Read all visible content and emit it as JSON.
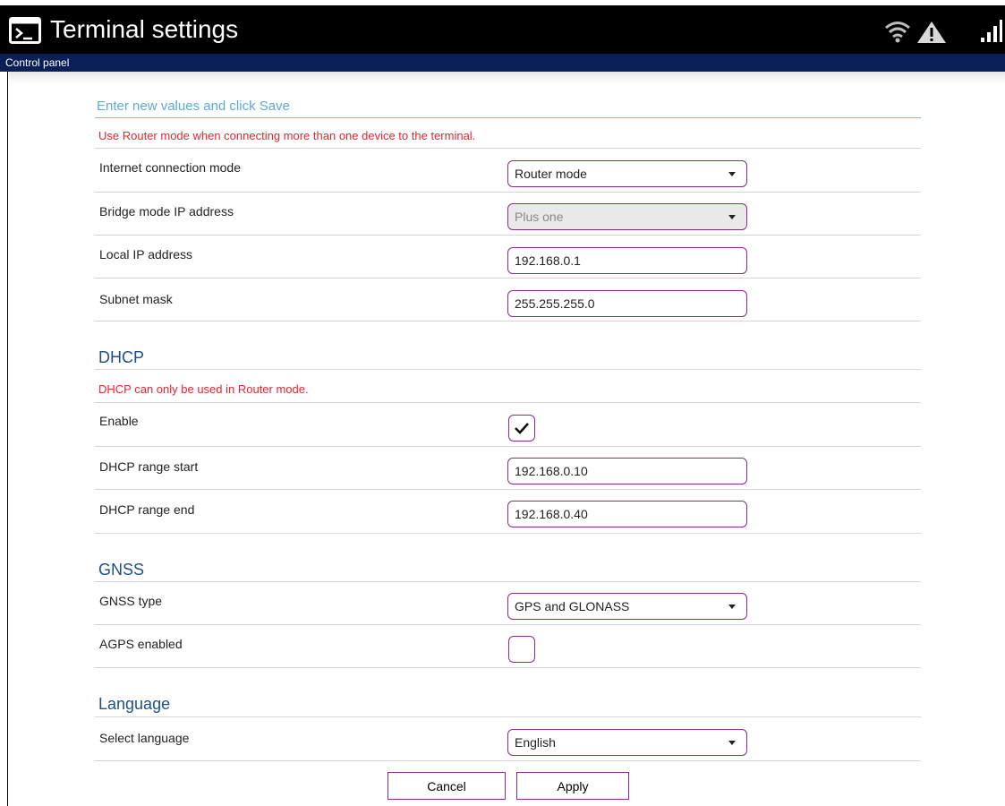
{
  "header": {
    "title": "Terminal settings",
    "icons": [
      "terminal-icon",
      "wifi-icon",
      "warning-icon",
      "signal-icon"
    ]
  },
  "subbar": {
    "label": "Control panel"
  },
  "intro": "Enter new values and click Save",
  "network": {
    "note": "Use Router mode when connecting more than one device to the terminal.",
    "connection_mode": {
      "label": "Internet connection mode",
      "value": "Router mode"
    },
    "bridge_ip": {
      "label": "Bridge mode IP address",
      "value": "Plus one",
      "disabled": true
    },
    "local_ip": {
      "label": "Local IP address",
      "value": "192.168.0.1"
    },
    "subnet": {
      "label": "Subnet mask",
      "value": "255.255.255.0"
    }
  },
  "dhcp": {
    "title": "DHCP",
    "note": "DHCP can only be used in Router mode.",
    "enable": {
      "label": "Enable",
      "checked": true
    },
    "range_start": {
      "label": "DHCP range start",
      "value": "192.168.0.10"
    },
    "range_end": {
      "label": "DHCP range end",
      "value": "192.168.0.40"
    }
  },
  "gnss": {
    "title": "GNSS",
    "type": {
      "label": "GNSS type",
      "value": "GPS and GLONASS"
    },
    "agps": {
      "label": "AGPS enabled",
      "checked": false
    }
  },
  "language": {
    "title": "Language",
    "select": {
      "label": "Select language",
      "value": "English"
    }
  },
  "buttons": {
    "cancel": "Cancel",
    "apply": "Apply"
  },
  "colors": {
    "header_bg": "#000000",
    "subbar_bg": "#0a1f56",
    "accent_border": "#8a2c8c",
    "intro_text": "#5fa9d6",
    "warning_text": "#e4262d",
    "section_title": "#1e4f8c"
  }
}
